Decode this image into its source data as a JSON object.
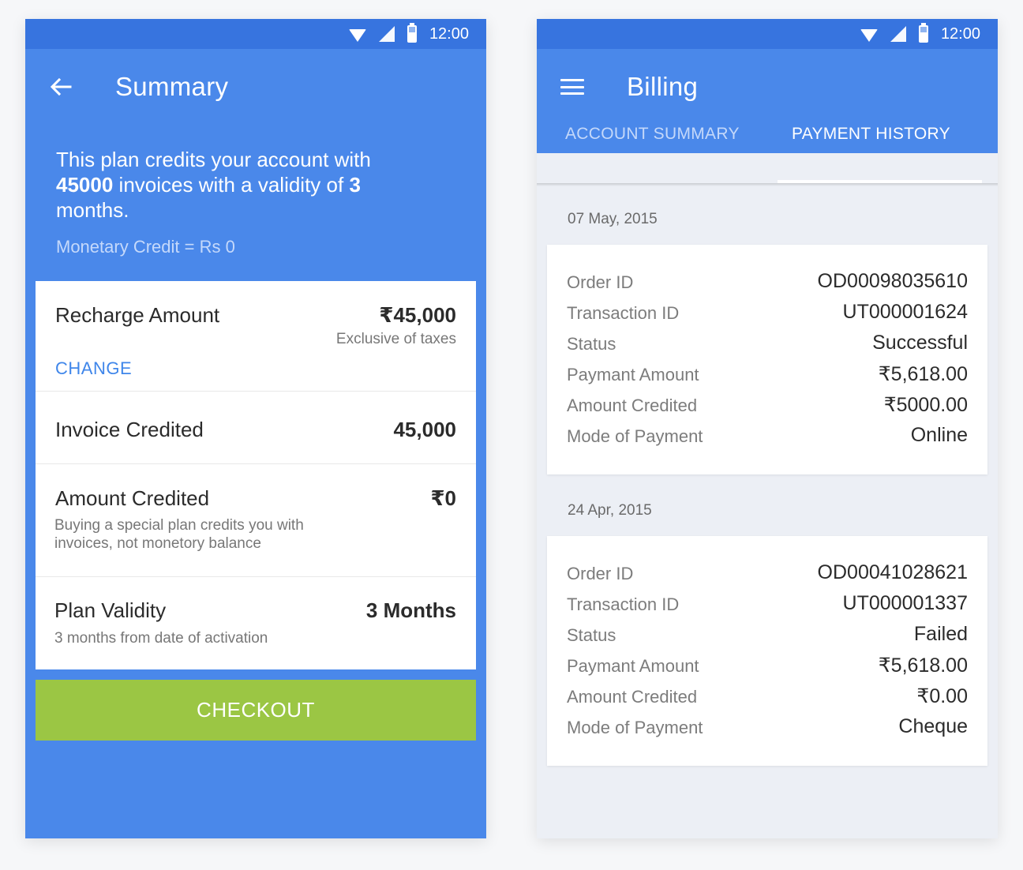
{
  "summary": {
    "status_time": "12:00",
    "title": "Summary",
    "intro_1": "This plan credits your account with",
    "intro_invoices": "45000",
    "intro_2": " invoices with a validity of ",
    "intro_months": "3",
    "intro_3": "months.",
    "monetary_credit": "Monetary Credit = Rs 0",
    "recharge": {
      "label": "Recharge Amount",
      "value": "₹45,000",
      "sub": "Exclusive of taxes",
      "change_label": "CHANGE"
    },
    "invoice": {
      "label": "Invoice Credited",
      "value": "45,000"
    },
    "amount": {
      "label": "Amount Credited",
      "value": "₹0",
      "sub_1": "Buying a special plan credits you with",
      "sub_2": "invoices, not monetory balance"
    },
    "validity": {
      "label": "Plan Validity",
      "value": "3 Months",
      "sub": "3 months from date of activation"
    },
    "checkout_label": "CHECKOUT"
  },
  "billing": {
    "status_time": "12:00",
    "title": "Billing",
    "tabs": [
      "ACCOUNT SUMMARY",
      "PAYMENT HISTORY"
    ],
    "active_tab": "PAYMENT HISTORY",
    "labels": [
      "Order ID",
      "Transaction ID",
      "Status",
      "Paymant Amount",
      "Amount Credited",
      "Mode of Payment"
    ],
    "payments": [
      {
        "date": "07 May, 2015",
        "values": [
          "OD00098035610",
          "UT000001624",
          "Successful",
          "₹5,618.00",
          "₹5000.00",
          "Online"
        ]
      },
      {
        "date": "24 Apr, 2015",
        "values": [
          "OD00041028621",
          "UT000001337",
          "Failed",
          "₹5,618.00",
          "₹0.00",
          "Cheque"
        ]
      }
    ]
  },
  "colors": {
    "primary": "#4a88ea",
    "status_bar": "#3774df",
    "checkout": "#9bc644",
    "link": "#3f86ea"
  },
  "icons": [
    "wifi-icon",
    "signal-icon",
    "battery-icon",
    "back-arrow-icon",
    "menu-icon"
  ]
}
